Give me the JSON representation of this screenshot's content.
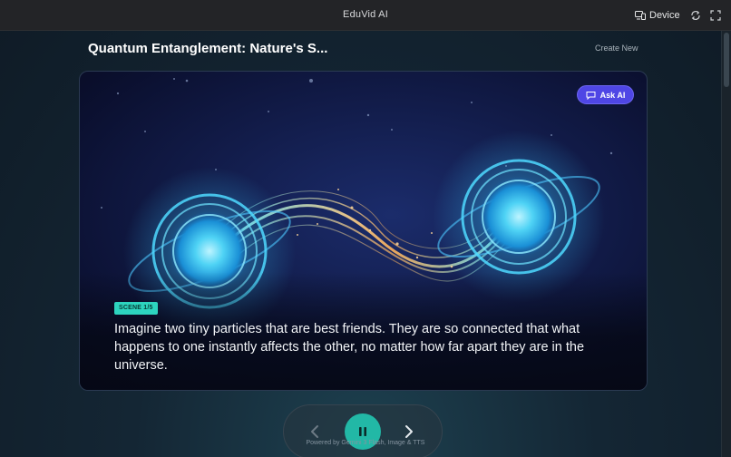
{
  "app": {
    "title": "EduVid AI"
  },
  "topbar": {
    "device_label": "Device",
    "icons": [
      "device-icon",
      "rotate-icon",
      "fullscreen-icon"
    ]
  },
  "header": {
    "title": "Quantum Entanglement: Nature's S...",
    "create_new_label": "Create New"
  },
  "scene": {
    "ask_ai_label": "Ask AI",
    "badge": "SCENE 1/5",
    "narration": "Imagine two tiny particles that are best friends. They are so connected that what happens to one instantly affects the other, no matter how far apart they are in the universe."
  },
  "controls": {
    "icons": [
      "chevron-left-icon",
      "pause-icon",
      "chevron-right-icon"
    ],
    "powered_by": "Powered by Gemini 3 Flash, Image & TTS"
  },
  "colors": {
    "accent_teal": "#22b8a6",
    "ask_ai": "#4f46e5",
    "badge": "#2dd4bf",
    "topbar": "#232427"
  }
}
